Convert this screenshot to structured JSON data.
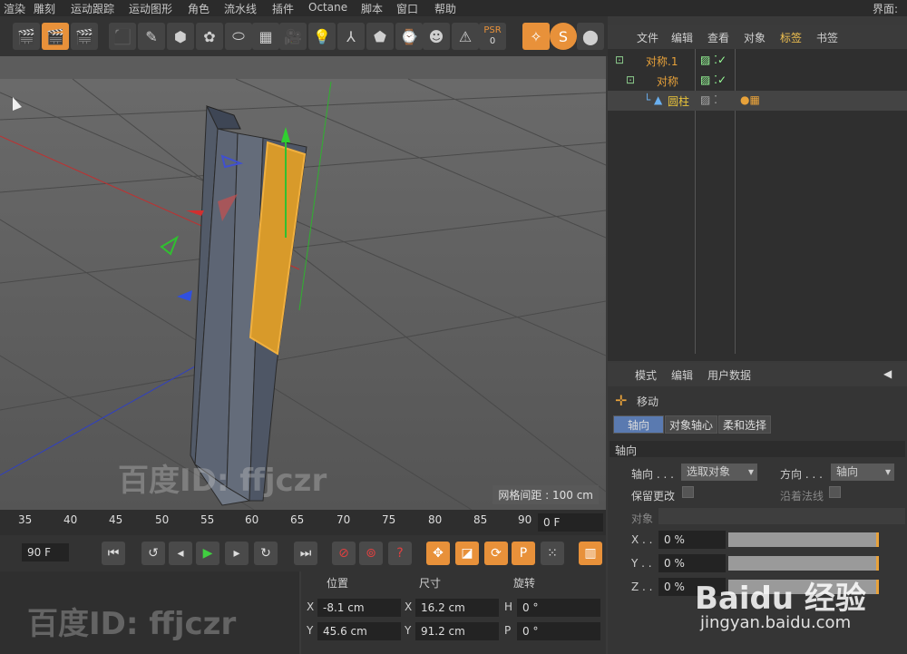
{
  "menu": [
    "渲染",
    "雕刻",
    "运动跟踪",
    "运动图形",
    "角色",
    "流水线",
    "插件",
    "Octane",
    "脚本",
    "窗口",
    "帮助"
  ],
  "menu_right": "界面:",
  "toolbar": {
    "psr_label": "PSR",
    "psr_value": "0"
  },
  "object_manager": {
    "tabs": [
      "文件",
      "编辑",
      "查看",
      "对象",
      "标签",
      "书签"
    ],
    "objects": [
      {
        "name": "对称.1",
        "color": "#e8a23a"
      },
      {
        "name": "对称",
        "color": "#e8a23a"
      },
      {
        "name": "圆柱",
        "color": "#e8c23a"
      }
    ]
  },
  "viewport": {
    "grid_label": "网格间距 : 100 cm"
  },
  "timeline": {
    "ticks": [
      "35",
      "40",
      "45",
      "50",
      "55",
      "60",
      "65",
      "70",
      "75",
      "80",
      "85",
      "90"
    ],
    "current_frame": "0 F",
    "end_frame": "90 F"
  },
  "coordinates": {
    "headers": {
      "position": "位置",
      "size": "尺寸",
      "rotation": "旋转"
    },
    "rows": [
      {
        "axis": "X",
        "pos": "-8.1 cm",
        "size_axis": "X",
        "size": "16.2 cm",
        "rot_axis": "H",
        "rot": "0 °"
      },
      {
        "axis": "Y",
        "pos": "45.6 cm",
        "size_axis": "Y",
        "size": "91.2 cm",
        "rot_axis": "P",
        "rot": "0 °"
      }
    ]
  },
  "attributes": {
    "tabs": [
      "模式",
      "编辑",
      "用户数据"
    ],
    "tool_name": "移动",
    "subtabs": [
      "轴向",
      "对象轴心",
      "柔和选择"
    ],
    "section": "轴向",
    "axis_label": "轴向 . . .",
    "axis_value": "选取对象",
    "direction_label": "方向 . . .",
    "direction_value": "轴向",
    "keep_changes": "保留更改",
    "along_normal": "沿着法线",
    "object_label": "对象",
    "xyz": [
      {
        "label": "X . .",
        "value": "0 %"
      },
      {
        "label": "Y . .",
        "value": "0 %"
      },
      {
        "label": "Z . .",
        "value": "0 %"
      }
    ]
  },
  "watermarks": {
    "baidu_id": "百度ID: ffjczr",
    "baidu_brand": "Baidu 经验",
    "baidu_url": "jingyan.baidu.com"
  }
}
